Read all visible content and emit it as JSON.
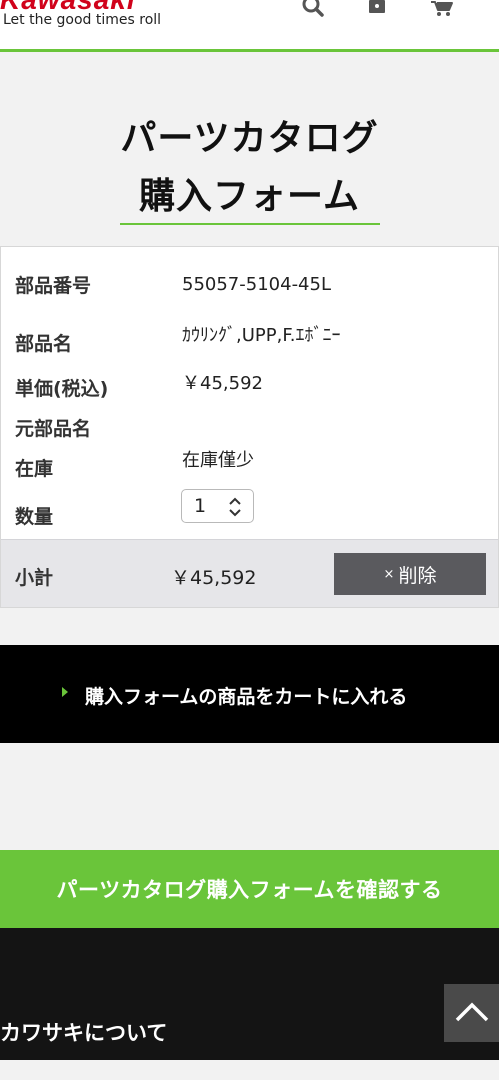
{
  "header": {
    "logo": "Kawasaki",
    "tagline": "Let the good times roll",
    "icons": [
      "search-icon",
      "lock-icon",
      "cart-icon"
    ]
  },
  "title": {
    "line1": "パーツカタログ",
    "line2": "購入フォーム"
  },
  "item": {
    "labels": {
      "part_number": "部品番号",
      "part_name": "部品名",
      "unit_price": "単価(税込)",
      "original_part_name": "元部品名",
      "stock": "在庫",
      "quantity": "数量"
    },
    "part_number": "55057-5104-45L",
    "part_name": "ｶｳﾘﾝｸﾞ,UPP,F.ｴﾎﾞﾆｰ",
    "unit_price": "￥45,592",
    "original_part_name": "",
    "stock": "在庫僅少",
    "quantity": "1"
  },
  "subtotal": {
    "label": "小計",
    "value": "￥45,592",
    "delete_symbol": "×",
    "delete_label": "削除"
  },
  "cart_button": "購入フォームの商品をカートに入れる",
  "confirm_button": "パーツカタログ購入フォームを確認する",
  "footer": {
    "about_link": "カワサキについて"
  },
  "colors": {
    "accent_green": "#6ac53a",
    "brand_red": "#d0021b",
    "dark": "#000000"
  }
}
